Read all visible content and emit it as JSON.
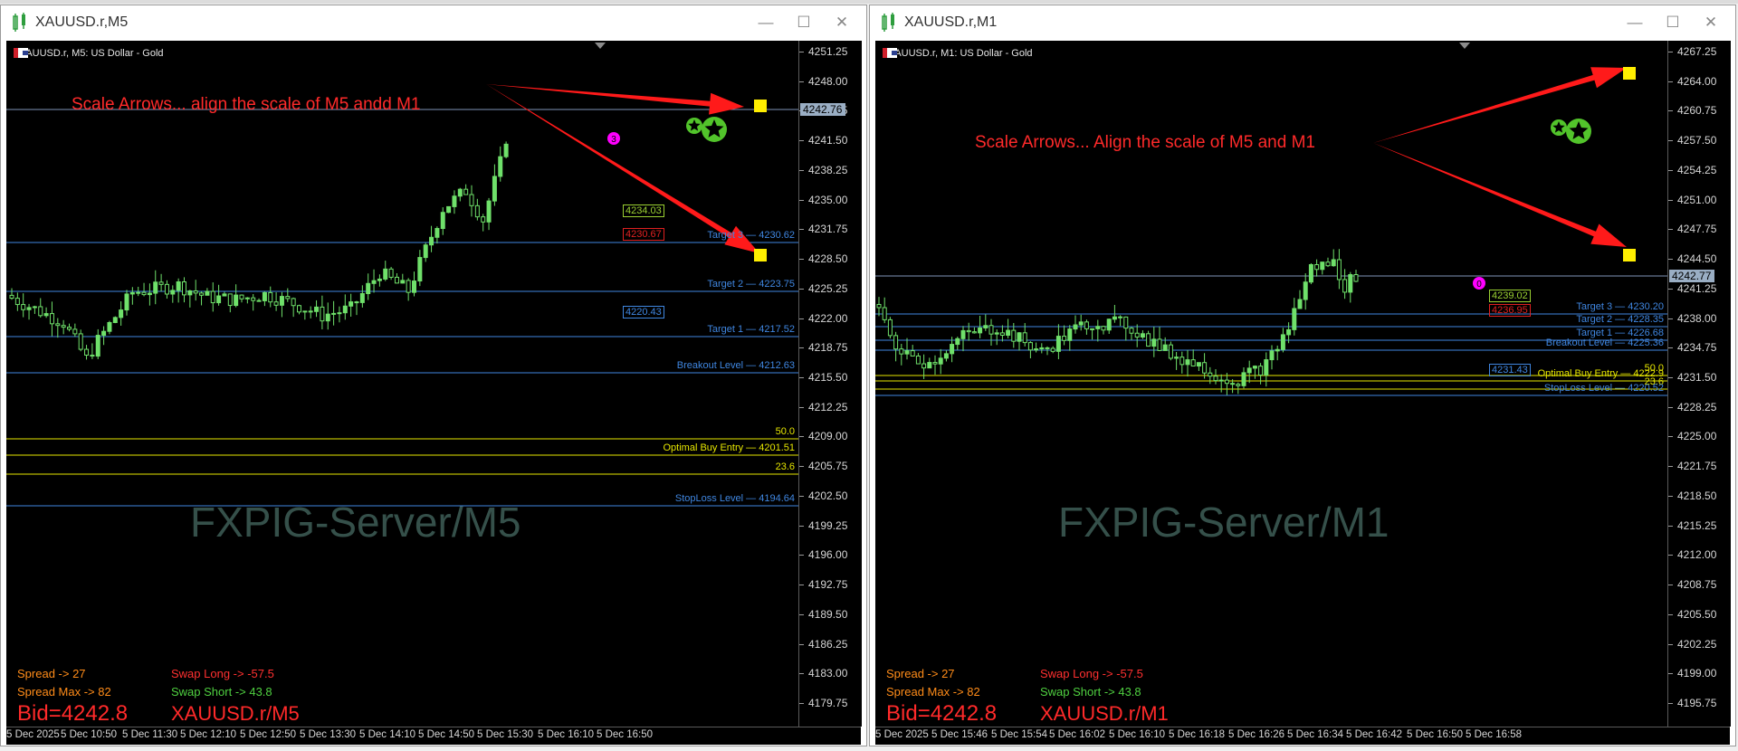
{
  "windows": [
    {
      "title": "XAUUSD.r,M5",
      "symbol_line": "XAUUSD.r, M5:  US Dollar - Gold",
      "annotation": "Scale Arrows... align the scale of M5 andd M1",
      "watermark": "FXPIG-Server/M5",
      "current_price": "4242.76",
      "price_ticks": [
        "4251.25",
        "4248.00",
        "4244.75",
        "4241.50",
        "4238.25",
        "4235.00",
        "4231.75",
        "4228.50",
        "4225.25",
        "4222.00",
        "4218.75",
        "4215.50",
        "4212.25",
        "4209.00",
        "4205.75",
        "4202.50",
        "4199.25",
        "4196.00",
        "4192.75",
        "4189.50",
        "4186.25",
        "4183.00",
        "4179.75"
      ],
      "time_ticks": [
        "5 Dec 2025",
        "5 Dec 10:50",
        "5 Dec 11:30",
        "5 Dec 12:10",
        "5 Dec 12:50",
        "5 Dec 13:30",
        "5 Dec 14:10",
        "5 Dec 14:50",
        "5 Dec 15:30",
        "5 Dec 16:10",
        "5 Dec 16:50"
      ],
      "levels": [
        {
          "label": "Target 3 — 4230.62",
          "color": "#3f86e0"
        },
        {
          "label": "Target 2 — 4223.75",
          "color": "#3f86e0"
        },
        {
          "label": "Target 1 — 4217.52",
          "color": "#3f86e0"
        },
        {
          "label": "Breakout Level — 4212.63",
          "color": "#3f86e0"
        },
        {
          "label": "50.0",
          "color": "#e6e600"
        },
        {
          "label": "Optimal Buy Entry — 4201.51",
          "color": "#e6e600"
        },
        {
          "label": "23.6",
          "color": "#e6e600"
        },
        {
          "label": "StopLoss Level — 4194.64",
          "color": "#3f86e0"
        }
      ],
      "price_boxes": [
        {
          "text": "4234.03",
          "color": "#9ad032"
        },
        {
          "text": "4230.67",
          "color": "#e02020"
        },
        {
          "text": "4220.43",
          "color": "#3f86e0"
        }
      ],
      "signal_count": "3",
      "info": {
        "spread": "Spread -> 27",
        "spread_max": "Spread Max -> 82",
        "swap_long": "Swap Long -> -57.5",
        "swap_short": "Swap Short -> 43.8",
        "bid": "Bid=4242.8",
        "symbol_tf": "XAUUSD.r/M5"
      }
    },
    {
      "title": "XAUUSD.r,M1",
      "symbol_line": "XAUUSD.r, M1:  US Dollar - Gold",
      "annotation": "Scale Arrows... Align the scale of M5 and M1",
      "watermark": "FXPIG-Server/M1",
      "current_price": "4242.77",
      "price_ticks": [
        "4267.25",
        "4264.00",
        "4260.75",
        "4257.50",
        "4254.25",
        "4251.00",
        "4247.75",
        "4244.50",
        "4241.25",
        "4238.00",
        "4234.75",
        "4231.50",
        "4228.25",
        "4225.00",
        "4221.75",
        "4218.50",
        "4215.25",
        "4212.00",
        "4208.75",
        "4205.50",
        "4202.25",
        "4199.00",
        "4195.75"
      ],
      "time_ticks": [
        "5 Dec 2025",
        "5 Dec 15:46",
        "5 Dec 15:54",
        "5 Dec 16:02",
        "5 Dec 16:10",
        "5 Dec 16:18",
        "5 Dec 16:26",
        "5 Dec 16:34",
        "5 Dec 16:42",
        "5 Dec 16:50",
        "5 Dec 16:58"
      ],
      "levels": [
        {
          "label": "Target 3 — 4230.20",
          "color": "#3f86e0"
        },
        {
          "label": "Target 2 — 4228.35",
          "color": "#3f86e0"
        },
        {
          "label": "Target 1 — 4226.68",
          "color": "#3f86e0"
        },
        {
          "label": "Breakout Level — 4225.36",
          "color": "#3f86e0"
        },
        {
          "label": "50.0",
          "color": "#e6e600"
        },
        {
          "label": "Optimal Buy Entry — 4222.9",
          "color": "#e6e600"
        },
        {
          "label": "23.6",
          "color": "#e6e600"
        },
        {
          "label": "StopLoss Level — 4220.52",
          "color": "#3f86e0"
        }
      ],
      "price_boxes": [
        {
          "text": "4239.02",
          "color": "#9ad032"
        },
        {
          "text": "4236.95",
          "color": "#e02020"
        },
        {
          "text": "4231.43",
          "color": "#3f86e0"
        }
      ],
      "signal_count": "0",
      "info": {
        "spread": "Spread -> 27",
        "spread_max": "Spread Max -> 82",
        "swap_long": "Swap Long -> -57.5",
        "swap_short": "Swap Short -> 43.8",
        "bid": "Bid=4242.8",
        "symbol_tf": "XAUUSD.r/M1"
      }
    }
  ],
  "icons": {
    "app": "chart-app-icon",
    "flag": "flag-icon",
    "chart_type": "chart-type-icon",
    "minimize": "minimize-icon",
    "maximize": "maximize-icon",
    "close": "close-icon",
    "green_stars": "star-badge-icon"
  },
  "colors": {
    "bull": "#6fe06a",
    "bear": "#0a3a0a",
    "level_blue": "#3f86e0",
    "level_yellow": "#e6e600",
    "arrow_red": "#ff1a1a",
    "marker_yellow": "#ffee00"
  }
}
